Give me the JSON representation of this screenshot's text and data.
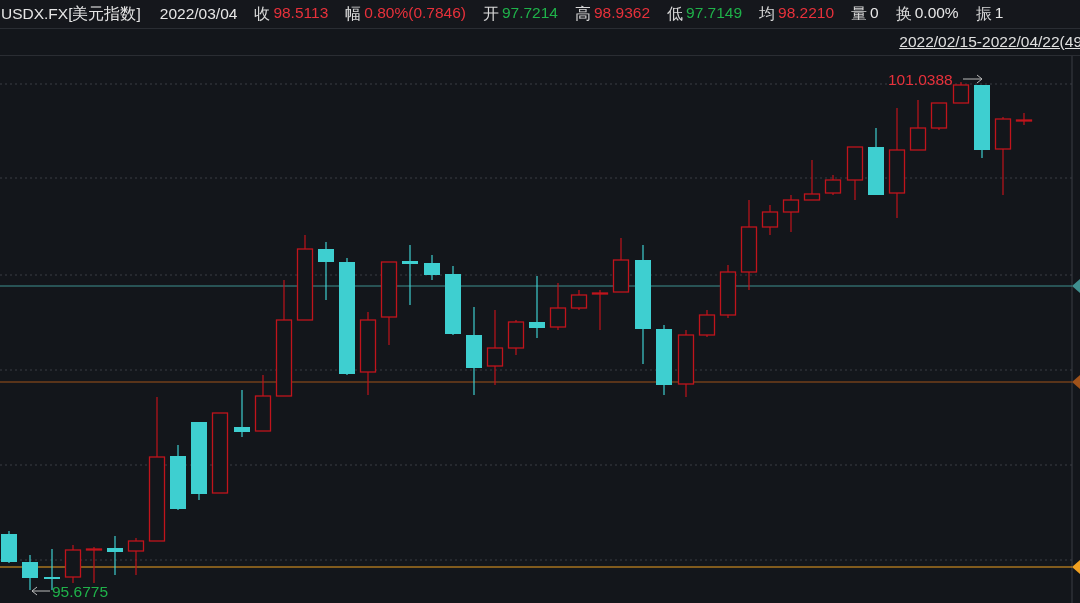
{
  "header": {
    "symbol": "USDX.FX[美元指数]",
    "date": "2022/03/04",
    "fields": [
      {
        "label": "收",
        "value": "98.5113",
        "color": "#e8313b"
      },
      {
        "label": "幅",
        "value": "0.80%(0.7846)",
        "color": "#e8313b"
      },
      {
        "label": "开",
        "value": "97.7214",
        "color": "#1fb24a"
      },
      {
        "label": "高",
        "value": "98.9362",
        "color": "#e8313b"
      },
      {
        "label": "低",
        "value": "97.7149",
        "color": "#1fb24a"
      },
      {
        "label": "均",
        "value": "98.2210",
        "color": "#e8313b"
      },
      {
        "label": "量",
        "value": "0",
        "color": "#e6e6e6"
      },
      {
        "label": "换",
        "value": "0.00%",
        "color": "#e6e6e6"
      },
      {
        "label": "振",
        "value": "1",
        "color": "#e6e6e6"
      }
    ]
  },
  "range": "2022/02/15-2022/04/22(49",
  "chart": {
    "max_label": "101.0388",
    "min_label": "95.6775"
  }
}
